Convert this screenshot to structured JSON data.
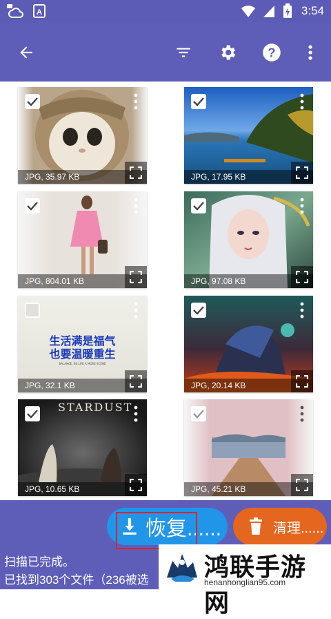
{
  "status_bar": {
    "time": "3:54"
  },
  "app_bar": {
    "icons": [
      "back-arrow-icon",
      "filter-icon",
      "gear-icon",
      "help-icon",
      "more-vertical-icon"
    ]
  },
  "photos": [
    {
      "label": "JPG, 35.97 KB",
      "checked": true
    },
    {
      "label": "JPG, 17.95 KB",
      "checked": true
    },
    {
      "label": "JPG, 804.01 KB",
      "checked": true
    },
    {
      "label": "JPG, 97.08 KB",
      "checked": true
    },
    {
      "label": "JPG, 32.1 KB",
      "checked": false
    },
    {
      "label": "JPG, 20.14 KB",
      "checked": true
    },
    {
      "label": "JPG, 10.65 KB",
      "checked": true
    },
    {
      "label": "JPG, 45.21 KB",
      "checked": true
    }
  ],
  "poster_text": {
    "line1": "生活满是福气",
    "line2": "也要温暖重生",
    "small": "BALANCE, BE LIFE A MORE SCENE"
  },
  "stardust_text": "STARDUST",
  "actions": {
    "recover_label": "恢复......",
    "clean_label": "清理......"
  },
  "status": {
    "line1": "扫描已完成。",
    "line2": "已找到303个文件（236被选"
  },
  "watermark": {
    "title": "鸿联手游网",
    "url": "henanhonglian95.com"
  },
  "colors": {
    "primary": "#5e5db8",
    "recover": "#2196e8",
    "clean": "#e4661f",
    "highlight": "#e0202a"
  }
}
